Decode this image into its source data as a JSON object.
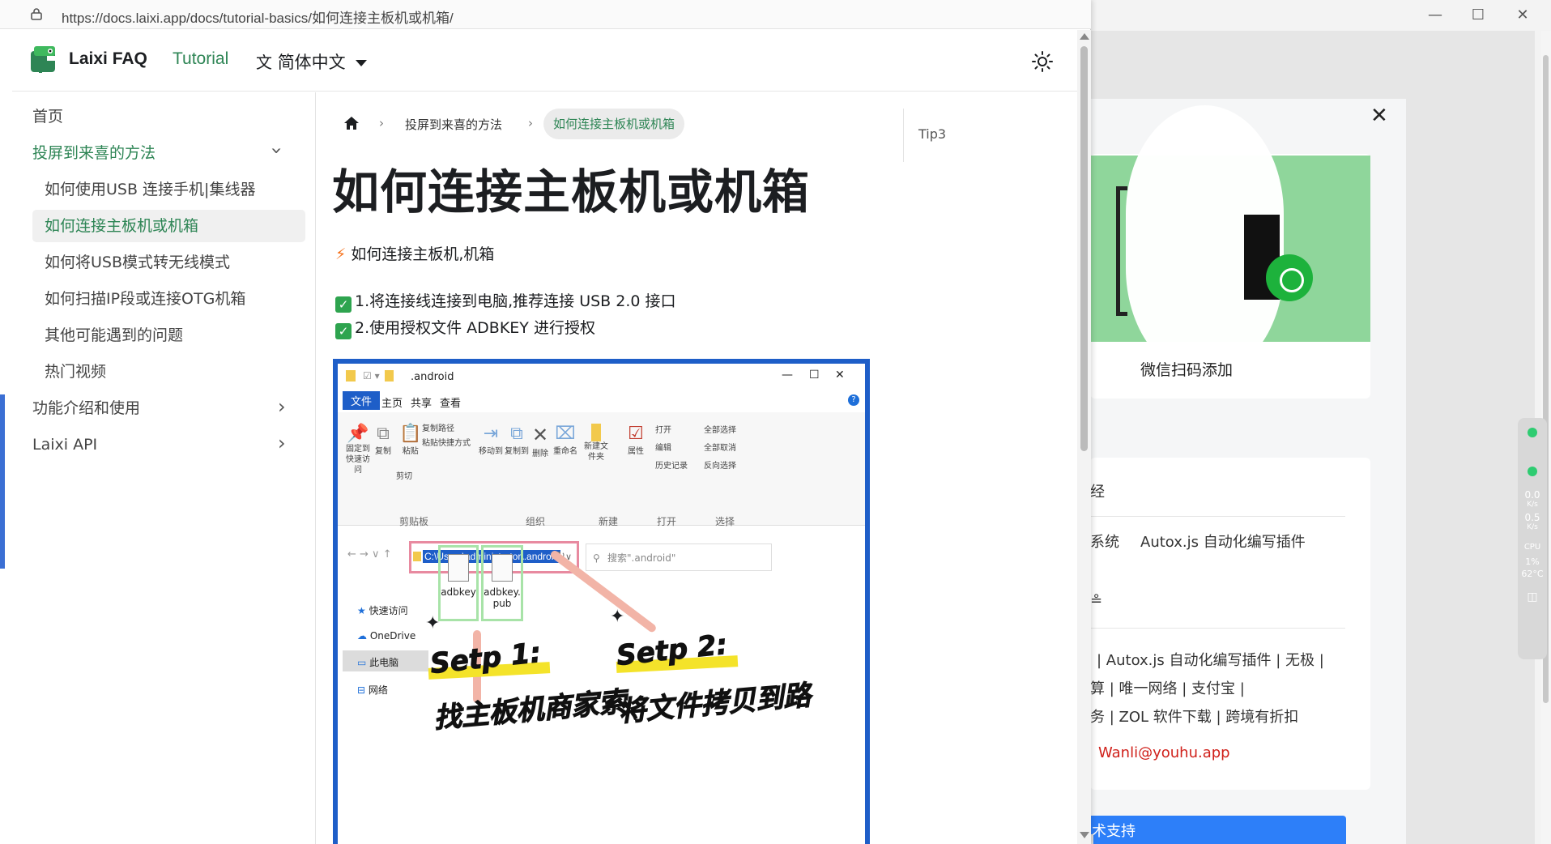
{
  "browser": {
    "url": "https://docs.laixi.app/docs/tutorial-basics/如何连接主板机或机箱/"
  },
  "navbar": {
    "brand": "Laixi FAQ",
    "tutorial": "Tutorial",
    "language": "简体中文"
  },
  "sidebar": {
    "items": [
      {
        "label": "首页"
      },
      {
        "label": "投屏到来喜的方法"
      },
      {
        "label": "如何使用USB 连接手机|集线器"
      },
      {
        "label": "如何连接主板机或机箱"
      },
      {
        "label": "如何将USB模式转无线模式"
      },
      {
        "label": "如何扫描IP段或连接OTG机箱"
      },
      {
        "label": "其他可能遇到的问题"
      },
      {
        "label": "热门视频"
      },
      {
        "label": "功能介绍和使用"
      },
      {
        "label": "Laixi API"
      }
    ]
  },
  "breadcrumb": {
    "parent": "投屏到来喜的方法",
    "current": "如何连接主板机或机箱"
  },
  "toc": {
    "item": "Tip3"
  },
  "article": {
    "title": "如何连接主板机或机箱",
    "intro": "如何连接主板机,机箱",
    "steps": [
      "1.将连接线连接到电脑,推荐连接 USB 2.0 接口",
      "2.使用授权文件 ADBKEY 进行授权"
    ]
  },
  "screenshot": {
    "window_title": ".android",
    "tabs": [
      "文件",
      "主页",
      "共享",
      "查看"
    ],
    "toolbar": {
      "pin": "固定到快速访问",
      "copy": "复制",
      "paste": "粘贴",
      "copy_path": "复制路径",
      "paste_shortcut": "粘贴快捷方式",
      "cut": "剪切",
      "move_to": "移动到",
      "copy_to": "复制到",
      "delete": "删除",
      "rename": "重命名",
      "new_folder": "新建文件夹",
      "properties": "属性",
      "open": "打开",
      "edit": "编辑",
      "history": "历史记录",
      "select_all": "全部选择",
      "select_none": "全部取消",
      "invert": "反向选择",
      "group_clipboard": "剪贴板",
      "group_organize": "组织",
      "group_new": "新建",
      "group_open": "打开",
      "group_select": "选择"
    },
    "address": "C:\\Users\\administrator\\.android",
    "search_placeholder": "搜索\".android\"",
    "nav": [
      "快速访问",
      "OneDrive",
      "此电脑",
      "网络"
    ],
    "files": [
      "adbkey",
      "adbkey.pub"
    ],
    "step1_title": "Setp 1:",
    "step1_text": "找主板机商家索",
    "step2_title": "Setp 2:",
    "step2_text": "将文件拷贝到路"
  },
  "right_window": {
    "qr_caption": "微信扫码添加",
    "row1_a": "系统",
    "row1_b": "Autox.js 自动化编写插件",
    "links1": "| Autox.js 自动化编写插件 | 无极 |",
    "links2": "算 | 唯一网络 | 支付宝 |",
    "links3": "务 | ZOL 软件下载 | 跨境有折扣",
    "email": "Wanli@youhu.app",
    "button": "技术支持"
  },
  "widget": {
    "up": "0.0",
    "up_unit": "K/s",
    "down": "0.5",
    "down_unit": "K/s",
    "cpu_label": "CPU",
    "cpu": "1%",
    "temp": "62°C"
  },
  "colors": {
    "accent": "#2e8555",
    "check": "#2ea44f",
    "shot_border": "#1e5ec8",
    "qr_green": "#8fd69b",
    "email": "#d0201a",
    "button_blue": "#2d7ff9"
  }
}
